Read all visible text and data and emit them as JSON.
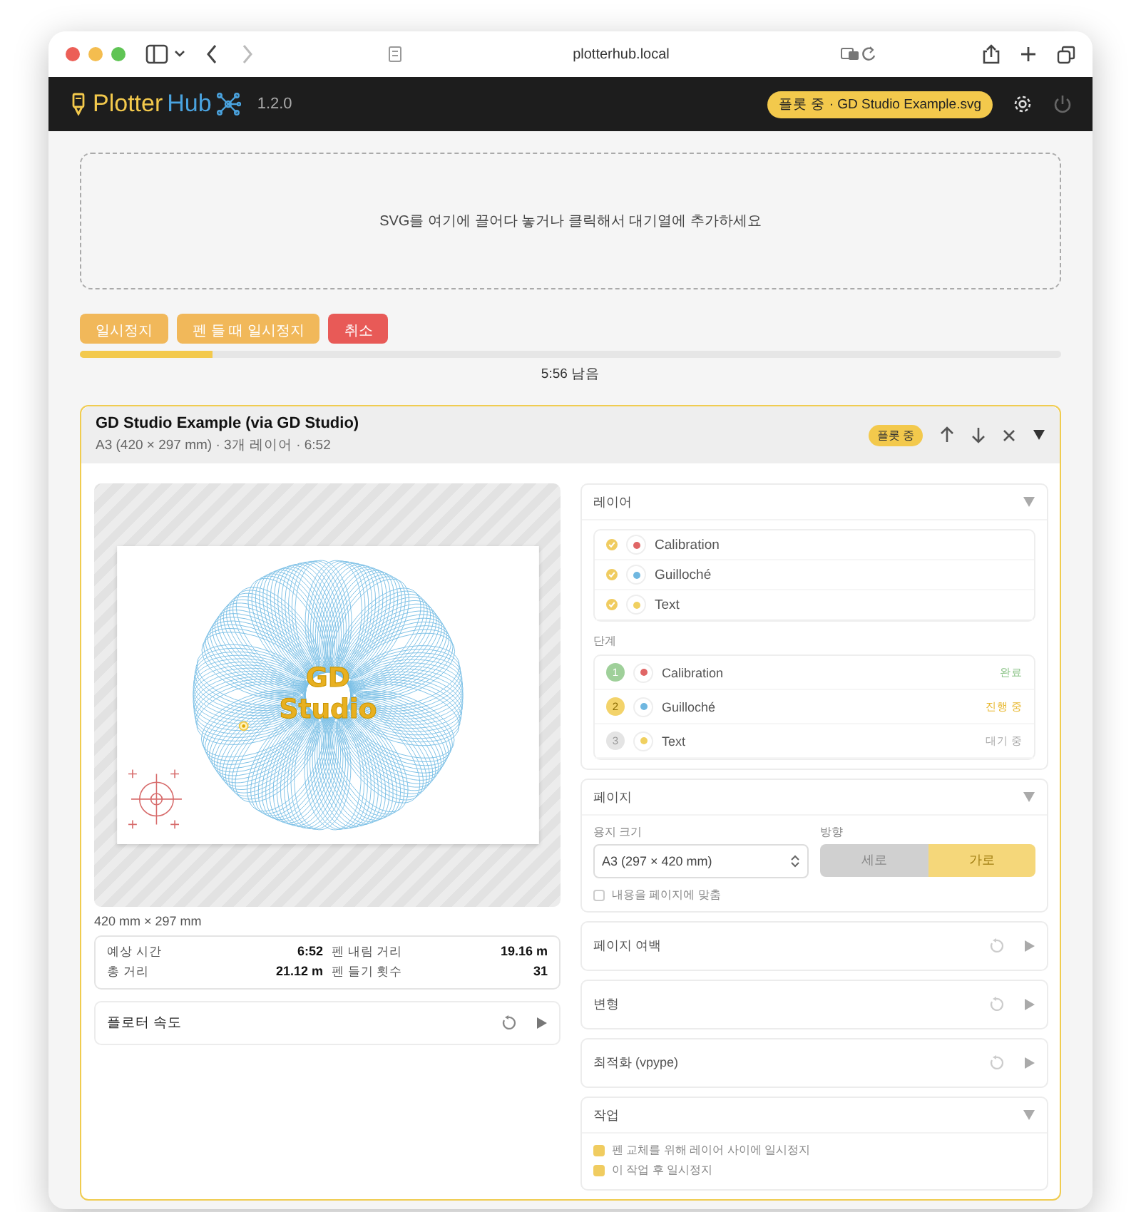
{
  "browser": {
    "url": "plotterhub.local"
  },
  "app": {
    "logo_first": "Plotter",
    "logo_second": "Hub",
    "version": "1.2.0",
    "status_badge": "플롯 중 · GD Studio Example.svg"
  },
  "dropzone": {
    "text": "SVG를 여기에 끌어다 놓거나 클릭해서 대기열에 추가하세요"
  },
  "controls": [
    {
      "label": "일시정지",
      "kind": "pause"
    },
    {
      "label": "펜 들 때 일시정지",
      "kind": "pause"
    },
    {
      "label": "취소",
      "kind": "cancel"
    }
  ],
  "progress": {
    "level": 0.135,
    "reading": "5:56 남음"
  },
  "job": {
    "title": "GD Studio Example (via GD Studio)",
    "subtitle": "A3 (420 × 297 mm) · 3개 레이어 · 6:52",
    "badge": "플롯 중",
    "expanded": true,
    "preview": {
      "art_text": [
        "GD",
        "Studio"
      ],
      "dimensions": "420 mm × 297 mm"
    },
    "stats": [
      {
        "label": "예상 시간",
        "value": "6:52"
      },
      {
        "label": "펜 내림 거리",
        "value": "19.16 m"
      },
      {
        "label": "총 거리",
        "value": "21.12 m"
      },
      {
        "label": "펜 들기 횟수",
        "value": "31"
      }
    ],
    "speed": {
      "title": "플로터 속도",
      "expanded": false
    },
    "layers": {
      "title": "레이어",
      "expanded": true,
      "items": [
        {
          "name": "Calibration",
          "checked": true,
          "color": "#e06666"
        },
        {
          "name": "Guilloché",
          "checked": true,
          "color": "#6fb7e0"
        },
        {
          "name": "Text",
          "checked": true,
          "color": "#f0d060"
        }
      ]
    },
    "steps": {
      "title": "단계",
      "items": [
        {
          "number": "1",
          "name": "Calibration",
          "status": "완료",
          "kind": "done",
          "color": "#e06666"
        },
        {
          "number": "2",
          "name": "Guilloché",
          "status": "진행 중",
          "kind": "active",
          "color": "#6fb7e0"
        },
        {
          "number": "3",
          "name": "Text",
          "status": "대기 중",
          "kind": "waiting",
          "color": "#f0d060"
        }
      ]
    },
    "page": {
      "title": "페이지",
      "expanded": true,
      "paper_label": "용지 크기",
      "paper_value": "A3 (297 × 420 mm)",
      "orientation_label": "방향",
      "orientations": [
        {
          "label": "세로",
          "selected": false
        },
        {
          "label": "가로",
          "selected": true
        }
      ],
      "fit": {
        "label": "내용을 페이지에 맞춤",
        "checked": false
      }
    },
    "sections": [
      {
        "title": "페이지 여백",
        "expanded": false
      },
      {
        "title": "변형",
        "expanded": false
      },
      {
        "title": "최적화 (vpype)",
        "expanded": false
      }
    ],
    "tasks": {
      "title": "작업",
      "expanded": true,
      "items": [
        {
          "label": "펜 교체를 위해 레이어 사이에 일시정지",
          "checked": true
        },
        {
          "label": "이 작업 후 일시정지",
          "checked": true
        }
      ]
    }
  }
}
